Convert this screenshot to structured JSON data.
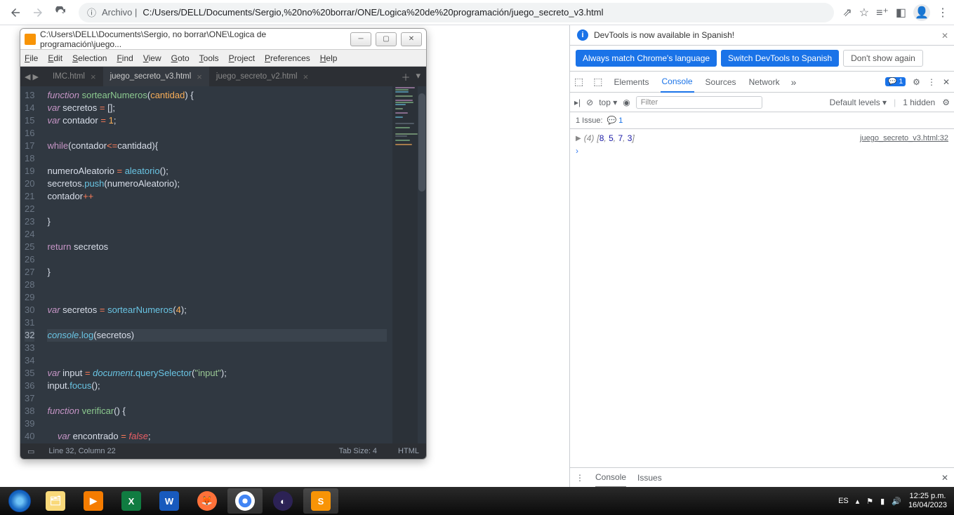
{
  "chrome": {
    "url_prefix": "Archivo |",
    "url": "C:/Users/DELL/Documents/Sergio,%20no%20borrar/ONE/Logica%20de%20programación/juego_secreto_v3.html"
  },
  "sublime": {
    "title": "C:\\Users\\DELL\\Documents\\Sergio, no borrar\\ONE\\Logica de programación\\juego...",
    "menus": [
      "File",
      "Edit",
      "Selection",
      "Find",
      "View",
      "Goto",
      "Tools",
      "Project",
      "Preferences",
      "Help"
    ],
    "tabs": [
      {
        "label": "IMC.html",
        "active": false
      },
      {
        "label": "juego_secreto_v3.html",
        "active": true
      },
      {
        "label": "juego_secreto_v2.html",
        "active": false
      }
    ],
    "status": {
      "cursor": "Line 32, Column 22",
      "tab_size": "Tab Size: 4",
      "syntax": "HTML"
    },
    "code_lines": [
      {
        "n": 13,
        "html": "<span class='kw'>function</span> <span class='fn-def'>sortearNumeros</span><span class='paren'>(</span><span class='num'>cantidad</span><span class='paren'>)</span> <span class='paren'>{</span>"
      },
      {
        "n": 14,
        "html": "<span class='kw'>var</span> secretos <span class='op'>=</span> <span class='paren'>[]</span>;"
      },
      {
        "n": 15,
        "html": "<span class='kw'>var</span> contador <span class='op'>=</span> <span class='num'>1</span>;"
      },
      {
        "n": 16,
        "html": ""
      },
      {
        "n": 17,
        "html": "<span class='kw2'>while</span><span class='paren'>(</span>contador<span class='op'>&lt;=</span>cantidad<span class='paren'>){</span>"
      },
      {
        "n": 18,
        "html": ""
      },
      {
        "n": 19,
        "html": "numeroAleatorio <span class='op'>=</span> <span class='fn'>aleatorio</span><span class='paren'>()</span>;"
      },
      {
        "n": 20,
        "html": "secretos.<span class='fn'>push</span><span class='paren'>(</span>numeroAleatorio<span class='paren'>)</span>;"
      },
      {
        "n": 21,
        "html": "contador<span class='op'>++</span>"
      },
      {
        "n": 22,
        "html": ""
      },
      {
        "n": 23,
        "html": "<span class='paren'>}</span>"
      },
      {
        "n": 24,
        "html": ""
      },
      {
        "n": 25,
        "html": "<span class='kw2'>return</span> secretos"
      },
      {
        "n": 26,
        "html": ""
      },
      {
        "n": 27,
        "html": "<span class='paren'>}</span>"
      },
      {
        "n": 28,
        "html": ""
      },
      {
        "n": 29,
        "html": ""
      },
      {
        "n": 30,
        "html": "<span class='kw'>var</span> secretos <span class='op'>=</span> <span class='fn'>sortearNumeros</span><span class='paren'>(</span><span class='num'>4</span><span class='paren'>)</span>;"
      },
      {
        "n": 31,
        "html": ""
      },
      {
        "n": 32,
        "html": "<span class='obj'>console</span>.<span class='fn'>log</span><span class='paren'>(</span>secretos<span class='paren'>)</span>",
        "current": true
      },
      {
        "n": 33,
        "html": ""
      },
      {
        "n": 34,
        "html": ""
      },
      {
        "n": 35,
        "html": "<span class='kw'>var</span> input <span class='op'>=</span> <span class='obj'>document</span>.<span class='fn'>querySelector</span><span class='paren'>(</span><span class='str'>\"input\"</span><span class='paren'>)</span>;"
      },
      {
        "n": 36,
        "html": "input.<span class='fn'>focus</span><span class='paren'>()</span>;"
      },
      {
        "n": 37,
        "html": ""
      },
      {
        "n": 38,
        "html": "<span class='kw'>function</span> <span class='fn-def'>verificar</span><span class='paren'>()</span> <span class='paren'>{</span>"
      },
      {
        "n": 39,
        "html": ""
      },
      {
        "n": 40,
        "html": "    <span class='kw'>var</span> encontrado <span class='op'>=</span> <span class='bool'>false</span>;"
      }
    ]
  },
  "devtools": {
    "banner": "DevTools is now available in Spanish!",
    "btn_always": "Always match Chrome's language",
    "btn_switch": "Switch DevTools to Spanish",
    "btn_dont": "Don't show again",
    "tabs": [
      "Elements",
      "Console",
      "Sources",
      "Network"
    ],
    "active_tab": "Console",
    "errors_badge": "1",
    "context": "top",
    "filter_placeholder": "Filter",
    "levels": "Default levels",
    "hidden": "1 hidden",
    "issues_label": "1 Issue:",
    "issues_count": "1",
    "log": {
      "count": "(4)",
      "array_text": "[8, 5, 7, 3]",
      "array": [
        8,
        5,
        7,
        3
      ],
      "source": "juego_secreto_v3.html:32"
    },
    "drawer": [
      "Console",
      "Issues"
    ]
  },
  "taskbar": {
    "lang": "ES",
    "time": "12:25 p.m.",
    "date": "16/04/2023"
  }
}
